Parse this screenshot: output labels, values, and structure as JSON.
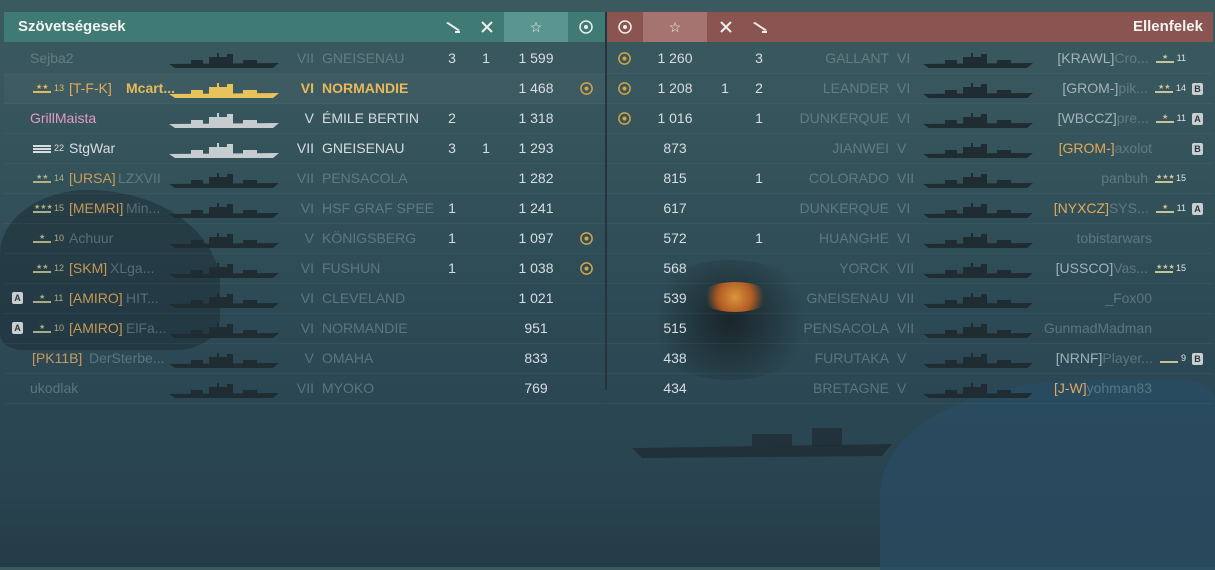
{
  "header": {
    "left_title": "Szövetségesek",
    "right_title": "Ellenfelek",
    "icons": [
      "torpedo-icon",
      "planes-destroyed-icon",
      "star-icon",
      "laurel-icon"
    ]
  },
  "colors": {
    "allies_header": "#3f7a74",
    "enemies_header": "#8a5450",
    "self_highlight": "#e8b95a",
    "clan_tag": "#e3a95c"
  },
  "allies": [
    {
      "rank": "",
      "player": "Sejba2",
      "clan": "",
      "tier": "VII",
      "ship": "GNEISENAU",
      "torpedoes": "3",
      "planes": "1",
      "xp": "1 599",
      "laurel": false,
      "division": "",
      "style": "dim"
    },
    {
      "rank": "13",
      "player": "Mcart...",
      "clan": "[T-F-K]",
      "tier": "VI",
      "ship": "NORMANDIE",
      "torpedoes": "",
      "planes": "",
      "xp": "1 468",
      "laurel": true,
      "division": "",
      "style": "me"
    },
    {
      "rank": "",
      "player": "GrillMaista",
      "clan": "",
      "tier": "V",
      "ship": "ÉMILE BERTIN",
      "torpedoes": "2",
      "planes": "",
      "xp": "1 318",
      "laurel": false,
      "division": "",
      "style": "friend"
    },
    {
      "rank": "22",
      "player": "StgWar",
      "clan": "",
      "tier": "VII",
      "ship": "GNEISENAU",
      "torpedoes": "3",
      "planes": "1",
      "xp": "1 293",
      "laurel": false,
      "division": "",
      "style": "normal"
    },
    {
      "rank": "14",
      "player": "LZXVII",
      "clan": "[URSA]",
      "tier": "VII",
      "ship": "PENSACOLA",
      "torpedoes": "",
      "planes": "",
      "xp": "1 282",
      "laurel": false,
      "division": "",
      "style": "dim"
    },
    {
      "rank": "15",
      "player": "Min...",
      "clan": "[MEMRI]",
      "tier": "VI",
      "ship": "HSF GRAF SPEE",
      "torpedoes": "1",
      "planes": "",
      "xp": "1 241",
      "laurel": false,
      "division": "",
      "style": "dim"
    },
    {
      "rank": "10",
      "player": "Achuur",
      "clan": "",
      "tier": "V",
      "ship": "KÖNIGSBERG",
      "torpedoes": "1",
      "planes": "",
      "xp": "1 097",
      "laurel": true,
      "division": "",
      "style": "dim"
    },
    {
      "rank": "12",
      "player": "XLga...",
      "clan": "[SKM]",
      "tier": "VI",
      "ship": "FUSHUN",
      "torpedoes": "1",
      "planes": "",
      "xp": "1 038",
      "laurel": true,
      "division": "",
      "style": "dim"
    },
    {
      "rank": "11",
      "player": "HIT...",
      "clan": "[AMIRO]",
      "tier": "VI",
      "ship": "CLEVELAND",
      "torpedoes": "",
      "planes": "",
      "xp": "1 021",
      "laurel": false,
      "division": "A",
      "style": "dim"
    },
    {
      "rank": "10",
      "player": "ElFa...",
      "clan": "[AMIRO]",
      "tier": "VI",
      "ship": "NORMANDIE",
      "torpedoes": "",
      "planes": "",
      "xp": "951",
      "laurel": false,
      "division": "A",
      "style": "dim"
    },
    {
      "rank": "",
      "player": "DerSterbe...",
      "clan": "[PK11B]",
      "tier": "V",
      "ship": "OMAHA",
      "torpedoes": "",
      "planes": "",
      "xp": "833",
      "laurel": false,
      "division": "",
      "style": "dim"
    },
    {
      "rank": "",
      "player": "ukodlak",
      "clan": "",
      "tier": "VII",
      "ship": "MYOKO",
      "torpedoes": "",
      "planes": "",
      "xp": "769",
      "laurel": false,
      "division": "",
      "style": "dim"
    }
  ],
  "enemies": [
    {
      "laurel": true,
      "xp": "1 260",
      "planes": "",
      "torpedoes": "3",
      "ship": "GALLANT",
      "tier": "VI",
      "clan": "[KRAWL]",
      "player": "Cro...",
      "rank": "11",
      "division": ""
    },
    {
      "laurel": true,
      "xp": "1 208",
      "planes": "1",
      "torpedoes": "2",
      "ship": "LEANDER",
      "tier": "VI",
      "clan": "[GROM-]",
      "player": "pik...",
      "rank": "14",
      "division": "B"
    },
    {
      "laurel": true,
      "xp": "1 016",
      "planes": "",
      "torpedoes": "1",
      "ship": "DUNKERQUE",
      "tier": "VI",
      "clan": "[WBCCZ]",
      "player": "pre...",
      "rank": "11",
      "division": "A"
    },
    {
      "laurel": false,
      "xp": "873",
      "planes": "",
      "torpedoes": "",
      "ship": "JIANWEI",
      "tier": "V",
      "clan": "[GROM-]",
      "player": "axolot",
      "rank": "",
      "division": "B"
    },
    {
      "laurel": false,
      "xp": "815",
      "planes": "",
      "torpedoes": "1",
      "ship": "COLORADO",
      "tier": "VII",
      "clan": "",
      "player": "panbuh",
      "rank": "15",
      "division": ""
    },
    {
      "laurel": false,
      "xp": "617",
      "planes": "",
      "torpedoes": "",
      "ship": "DUNKERQUE",
      "tier": "VI",
      "clan": "[NYXCZ]",
      "player": "SYS...",
      "rank": "11",
      "division": "A"
    },
    {
      "laurel": false,
      "xp": "572",
      "planes": "",
      "torpedoes": "1",
      "ship": "HUANGHE",
      "tier": "VI",
      "clan": "",
      "player": "tobistarwars",
      "rank": "",
      "division": ""
    },
    {
      "laurel": false,
      "xp": "568",
      "planes": "",
      "torpedoes": "",
      "ship": "YORCK",
      "tier": "VII",
      "clan": "[USSCO]",
      "player": "Vas...",
      "rank": "15",
      "division": ""
    },
    {
      "laurel": false,
      "xp": "539",
      "planes": "",
      "torpedoes": "",
      "ship": "GNEISENAU",
      "tier": "VII",
      "clan": "",
      "player": "_Fox00",
      "rank": "",
      "division": ""
    },
    {
      "laurel": false,
      "xp": "515",
      "planes": "",
      "torpedoes": "",
      "ship": "PENSACOLA",
      "tier": "VII",
      "clan": "",
      "player": "GunmadMadman",
      "rank": "",
      "division": ""
    },
    {
      "laurel": false,
      "xp": "438",
      "planes": "",
      "torpedoes": "",
      "ship": "FURUTAKA",
      "tier": "V",
      "clan": "[NRNF]",
      "player": "Player...",
      "rank": "9",
      "division": "B"
    },
    {
      "laurel": false,
      "xp": "434",
      "planes": "",
      "torpedoes": "",
      "ship": "BRETAGNE",
      "tier": "V",
      "clan": "[J-W]",
      "player": "yohman83",
      "rank": "",
      "division": ""
    }
  ]
}
